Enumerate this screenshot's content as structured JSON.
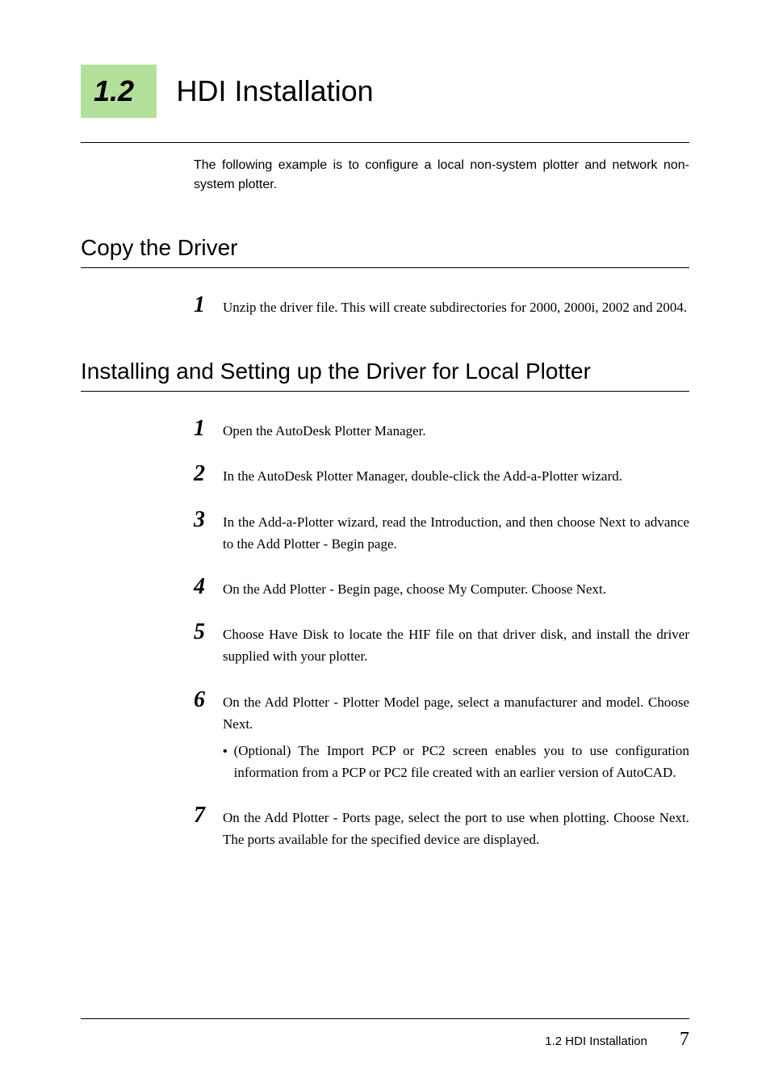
{
  "section": {
    "number": "1.2",
    "title": "HDI Installation",
    "intro": "The following example is to configure a local non-system plotter and network non-system plotter."
  },
  "subsections": [
    {
      "title": "Copy the Driver",
      "steps": [
        {
          "num": "1",
          "text": "Unzip the driver file. This will create subdirectories for 2000, 2000i, 2002 and 2004."
        }
      ]
    },
    {
      "title": "Installing and Setting up the Driver for Local Plotter",
      "steps": [
        {
          "num": "1",
          "text": "Open the AutoDesk Plotter Manager."
        },
        {
          "num": "2",
          "text": "In the AutoDesk Plotter Manager, double-click the Add-a-Plotter wizard."
        },
        {
          "num": "3",
          "text": "In the Add-a-Plotter wizard, read the Introduction, and then choose Next to advance to the Add Plotter - Begin page."
        },
        {
          "num": "4",
          "text": "On the Add Plotter - Begin page, choose My Computer. Choose Next."
        },
        {
          "num": "5",
          "text": "Choose Have Disk to locate the HIF file on that driver disk, and install the driver supplied with your plotter."
        },
        {
          "num": "6",
          "text": "On the Add Plotter - Plotter Model page, select a manufacturer and model. Choose Next.",
          "bullet": "(Optional) The Import PCP or PC2 screen enables you to use configuration information from a PCP or PC2 file created with an earlier version of AutoCAD."
        },
        {
          "num": "7",
          "text": "On the Add Plotter - Ports page, select the port to use when plotting. Choose Next. The ports available for the specified device are displayed."
        }
      ]
    }
  ],
  "footer": {
    "text": "1.2  HDI Installation",
    "page": "7"
  }
}
